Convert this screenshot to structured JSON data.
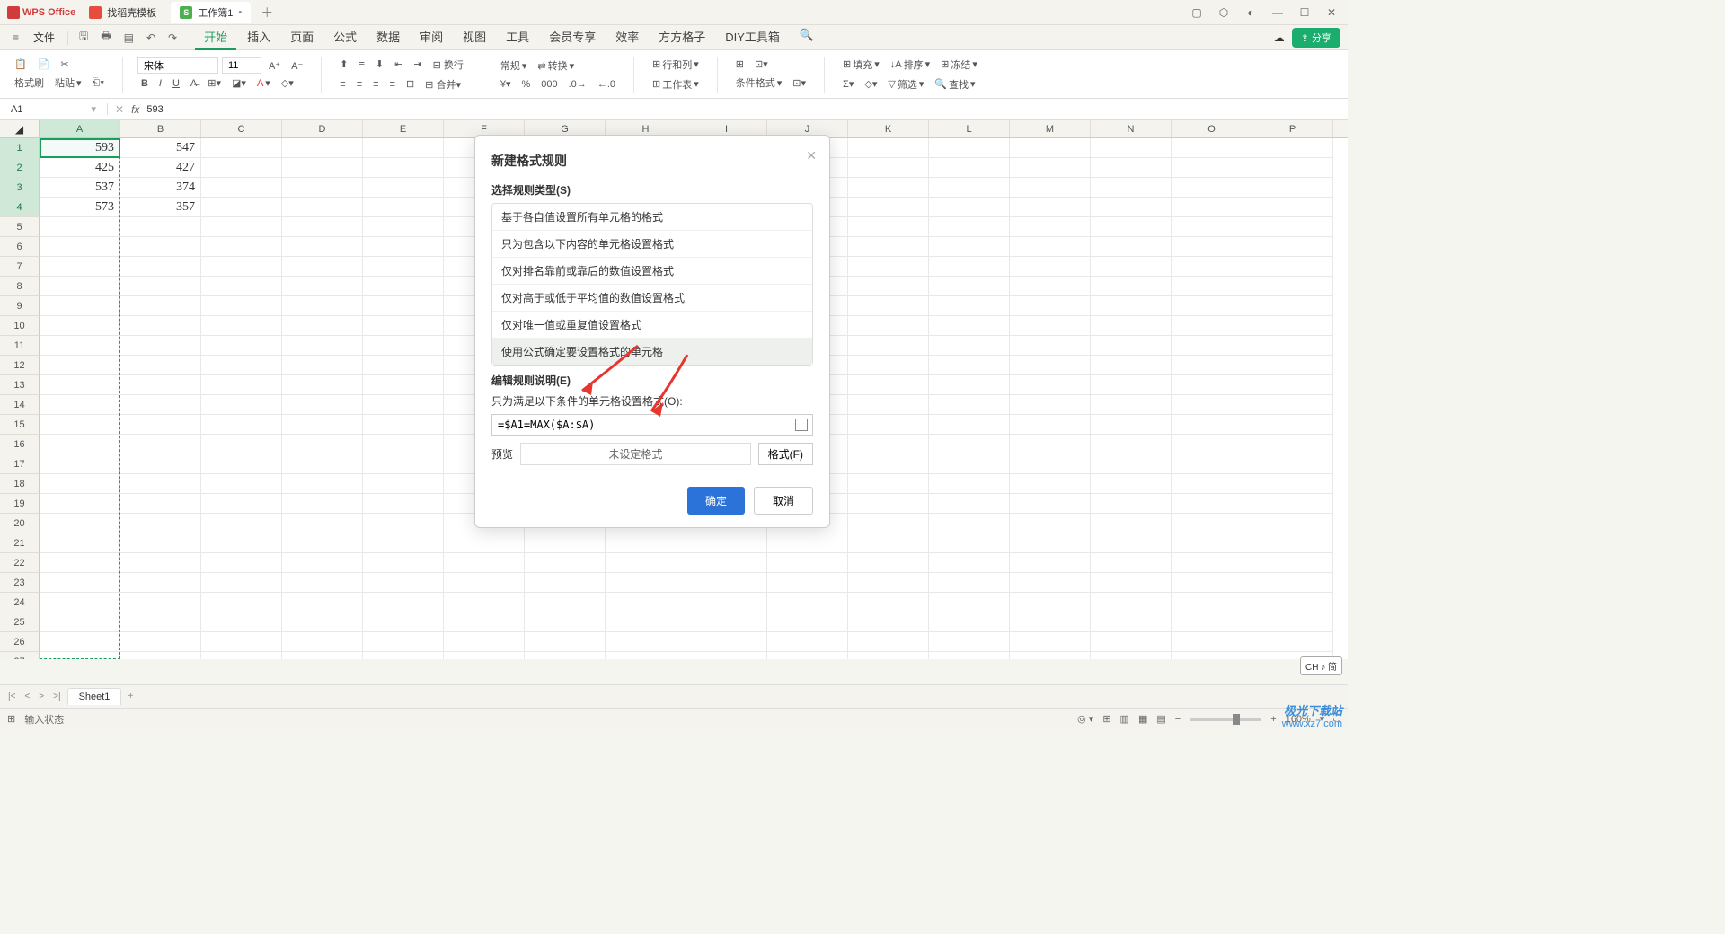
{
  "titlebar": {
    "app": "WPS Office",
    "tabs": [
      {
        "label": "找稻壳模板",
        "icon": "red"
      },
      {
        "label": "工作簿1",
        "icon": "green",
        "iconText": "S",
        "dirty": "•",
        "active": true
      }
    ]
  },
  "menubar": {
    "file": "文件",
    "tabs": [
      "开始",
      "插入",
      "页面",
      "公式",
      "数据",
      "审阅",
      "视图",
      "工具",
      "会员专享",
      "效率",
      "方方格子",
      "DIY工具箱"
    ],
    "active": "开始",
    "share": "分享"
  },
  "ribbon": {
    "clipboard": {
      "formatBrush": "格式刷",
      "paste": "粘贴"
    },
    "font": {
      "name": "宋体",
      "size": "11"
    },
    "number": {
      "general": "常规",
      "convert": "转换"
    },
    "rowcol": {
      "label": "行和列",
      "worksheet": "工作表"
    },
    "cond": {
      "label": "条件格式"
    },
    "fill": {
      "label": "填充"
    },
    "sort": {
      "label": "排序"
    },
    "freeze": {
      "label": "冻结"
    },
    "filter": {
      "label": "筛选"
    },
    "find": {
      "label": "查找"
    }
  },
  "formulaBar": {
    "nameBox": "A1",
    "fx": "fx",
    "value": "593"
  },
  "grid": {
    "columns": [
      "A",
      "B",
      "C",
      "D",
      "E",
      "F",
      "G",
      "H",
      "I",
      "J",
      "K",
      "L",
      "M",
      "N",
      "O",
      "P"
    ],
    "rowCount": 27,
    "data": {
      "A": [
        "593",
        "425",
        "537",
        "573"
      ],
      "B": [
        "547",
        "427",
        "374",
        "357"
      ]
    }
  },
  "dialog": {
    "title": "新建格式规则",
    "typeLabel": "选择规则类型(S)",
    "types": [
      "基于各自值设置所有单元格的格式",
      "只为包含以下内容的单元格设置格式",
      "仅对排名靠前或靠后的数值设置格式",
      "仅对高于或低于平均值的数值设置格式",
      "仅对唯一值或重复值设置格式",
      "使用公式确定要设置格式的单元格"
    ],
    "selectedTypeIdx": 5,
    "editLabel": "编辑规则说明(E)",
    "conditionLabel": "只为满足以下条件的单元格设置格式(O):",
    "formula": "=$A1=MAX($A:$A)",
    "previewLabel": "预览",
    "previewText": "未设定格式",
    "formatBtn": "格式(F)",
    "ok": "确定",
    "cancel": "取消"
  },
  "sheetTabs": {
    "sheet": "Sheet1"
  },
  "statusbar": {
    "mode": "输入状态",
    "zoom": "160%"
  },
  "ime": "CH ♪ 简",
  "watermark": {
    "name": "极光下载站",
    "url": "www.xz7.com"
  }
}
